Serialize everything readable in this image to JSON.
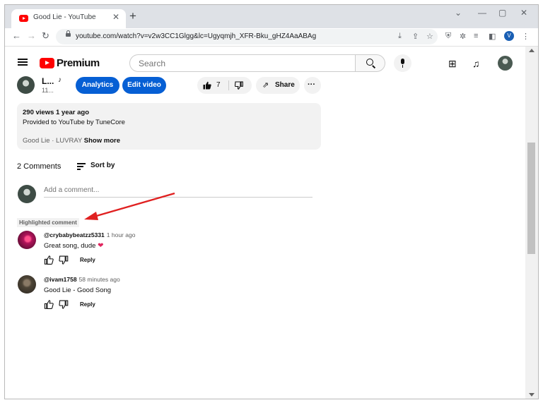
{
  "browser": {
    "tab_title": "Good Lie - YouTube",
    "tab_close": "✕",
    "new_tab": "+",
    "win_min": "⌄",
    "win_minimize": "—",
    "win_restore": "▢",
    "win_close": "✕",
    "url": "youtube.com/watch?v=v2w3CC1Glgg&lc=Ugyqmjh_XFR-Bku_gHZ4AaABAg",
    "profile_initial": "V"
  },
  "youtube": {
    "brand": "Premium",
    "search_placeholder": "Search"
  },
  "video": {
    "channel_name": "L...",
    "channel_subs": "11...",
    "analytics_label": "Analytics",
    "edit_label": "Edit video",
    "like_count": "7",
    "share_label": "Share",
    "more_label": "···"
  },
  "description": {
    "meta": "290 views  1 year ago",
    "line1": "Provided to YouTube by TuneCore",
    "line2_start": "Good Lie · LUVRAY",
    "show_more": "Show more"
  },
  "comments": {
    "count_label": "2 Comments",
    "sort_label": "Sort by",
    "add_placeholder": "Add a comment...",
    "highlight_label": "Highlighted comment",
    "items": [
      {
        "author": "@crybabybeatzz5331",
        "time": "1 hour ago",
        "text": "Great song, dude ",
        "reply": "Reply"
      },
      {
        "author": "@ivam1758",
        "time": "58 minutes ago",
        "text": "Good Lie - Good Song",
        "reply": "Reply"
      }
    ]
  },
  "colors": {
    "accent_blue": "#065fd4",
    "youtube_red": "#ff0000",
    "annotation_arrow": "#e02020"
  }
}
